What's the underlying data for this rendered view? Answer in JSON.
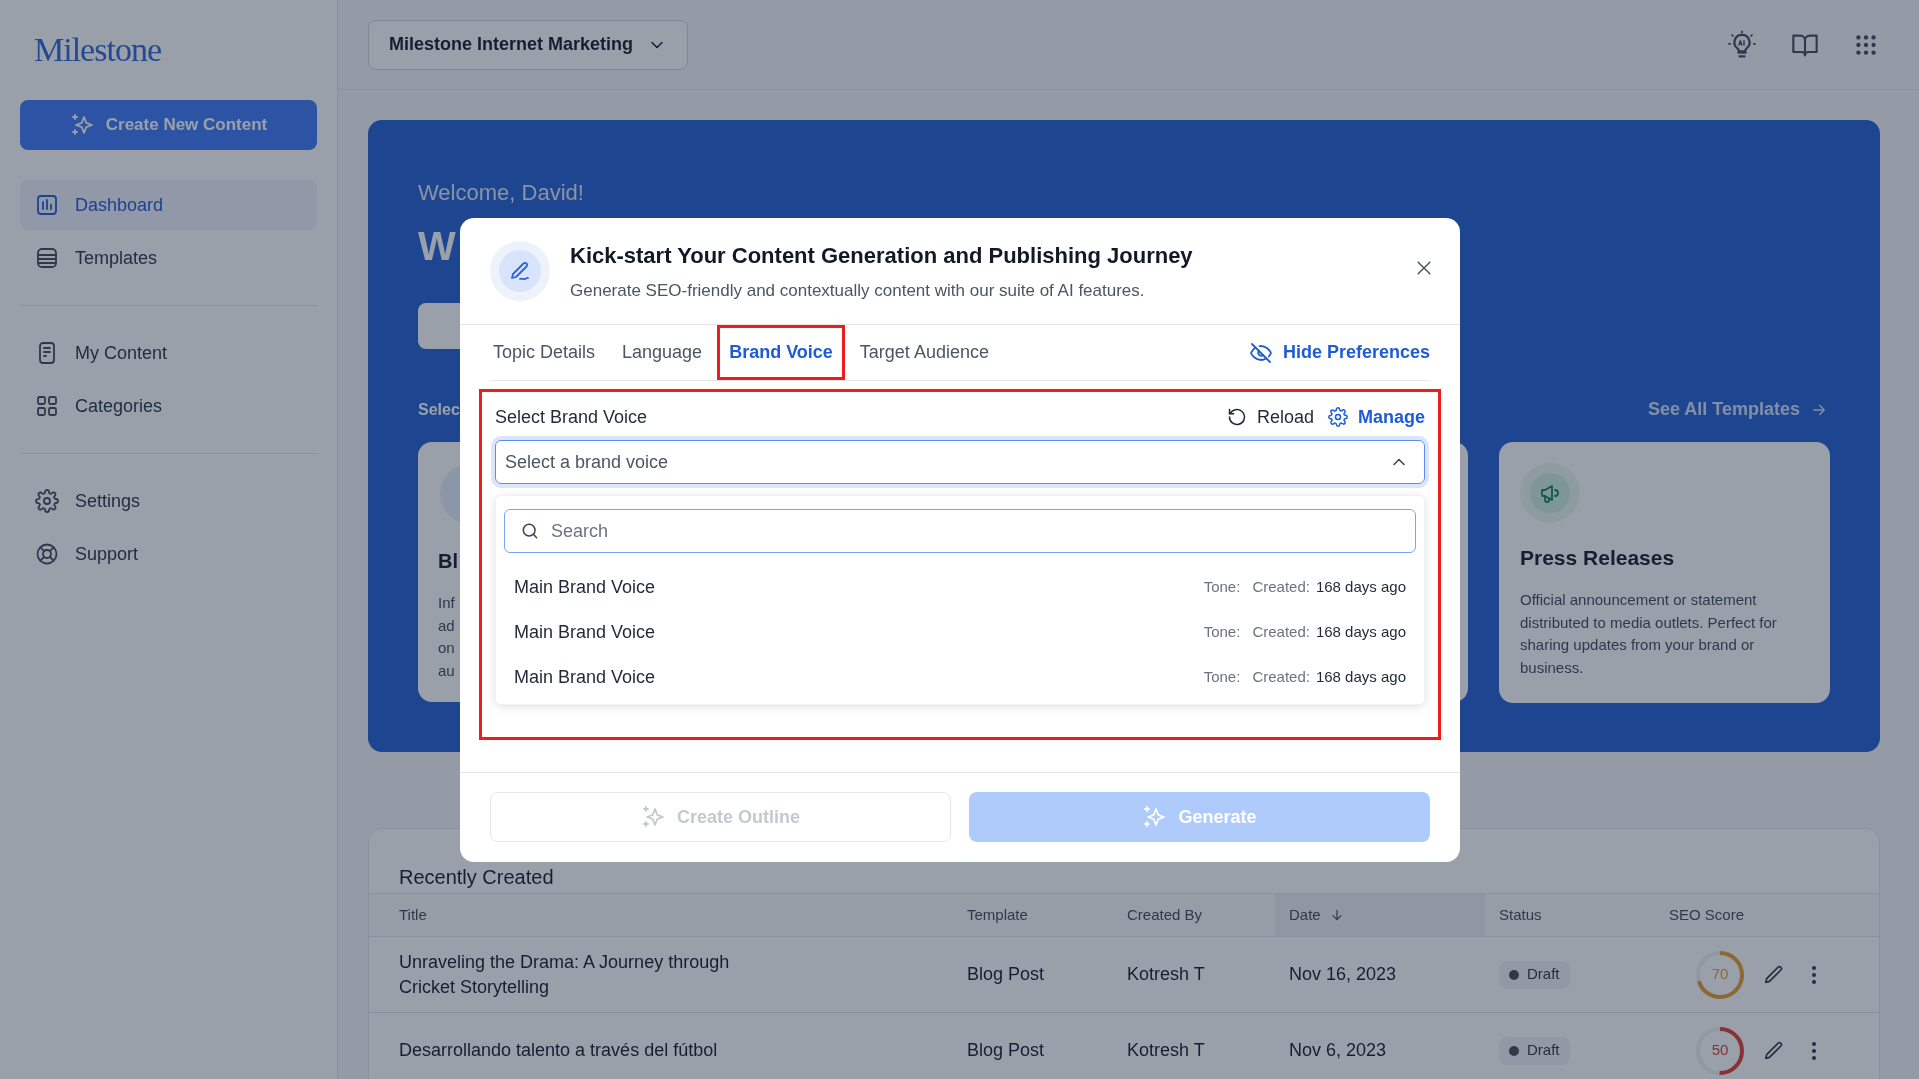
{
  "sidebar": {
    "logo": "Milestone",
    "create_button": "Create New Content",
    "groups": [
      [
        {
          "label": "Dashboard",
          "selected": true
        },
        {
          "label": "Templates",
          "selected": false
        }
      ],
      [
        {
          "label": "My Content",
          "selected": false
        },
        {
          "label": "Categories",
          "selected": false
        }
      ],
      [
        {
          "label": "Settings",
          "selected": false
        },
        {
          "label": "Support",
          "selected": false
        }
      ]
    ]
  },
  "topbar": {
    "workspace": "Milestone Internet Marketing"
  },
  "hero": {
    "greeting": "Welcome, David!",
    "heading": "W",
    "section_label": "Selec",
    "see_all": "See All Templates",
    "partial_card": {
      "title": "Bl",
      "description_lines": [
        "Inf",
        "ad",
        "on",
        "au"
      ]
    },
    "press_card": {
      "title": "Press Releases",
      "description": "Official announcement or statement distributed to media outlets. Perfect for sharing updates from your brand or business."
    }
  },
  "recent": {
    "title": "Recently Created",
    "columns": [
      {
        "label": "Title",
        "sorted": false
      },
      {
        "label": "Template",
        "sorted": false
      },
      {
        "label": "Created By",
        "sorted": false
      },
      {
        "label": "Date",
        "sorted": true
      },
      {
        "label": "Status",
        "sorted": false
      },
      {
        "label": "SEO Score",
        "sorted": false
      }
    ],
    "rows": [
      {
        "title": "Unraveling the Drama: A Journey through Cricket Storytelling",
        "template": "Blog Post",
        "created_by": "Kotresh T",
        "date": "Nov 16, 2023",
        "status": "Draft",
        "seo_score": "70"
      },
      {
        "title": "Desarrollando talento a través del fútbol",
        "template": "Blog Post",
        "created_by": "Kotresh T",
        "date": "Nov 6, 2023",
        "status": "Draft",
        "seo_score": "50"
      }
    ]
  },
  "modal": {
    "title": "Kick-start Your Content Generation and Publishing Journey",
    "subtitle": "Generate SEO-friendly and contextually content with our suite of AI features.",
    "tabs": [
      {
        "label": "Topic Details",
        "selected": false,
        "highlighted": false
      },
      {
        "label": "Language",
        "selected": false,
        "highlighted": false
      },
      {
        "label": "Brand Voice",
        "selected": true,
        "highlighted": true
      },
      {
        "label": "Target Audience",
        "selected": false,
        "highlighted": false
      }
    ],
    "hide_preferences": "Hide Preferences",
    "section": {
      "highlighted": true,
      "label": "Select Brand Voice",
      "reload": "Reload",
      "manage": "Manage",
      "select": {
        "placeholder": "Select a brand voice",
        "expanded": true
      },
      "search": {
        "placeholder": "Search"
      },
      "options": [
        {
          "name": "Main Brand Voice",
          "tone_label": "Tone:",
          "created_label": "Created:",
          "created": "168 days ago"
        },
        {
          "name": "Main Brand Voice",
          "tone_label": "Tone:",
          "created_label": "Created:",
          "created": "168 days ago"
        },
        {
          "name": "Main Brand Voice",
          "tone_label": "Tone:",
          "created_label": "Created:",
          "created": "168 days ago"
        }
      ]
    },
    "buttons": [
      {
        "label": "Create Outline",
        "kind": "secondary",
        "disabled": true
      },
      {
        "label": "Generate",
        "kind": "primary",
        "disabled": true
      }
    ]
  }
}
